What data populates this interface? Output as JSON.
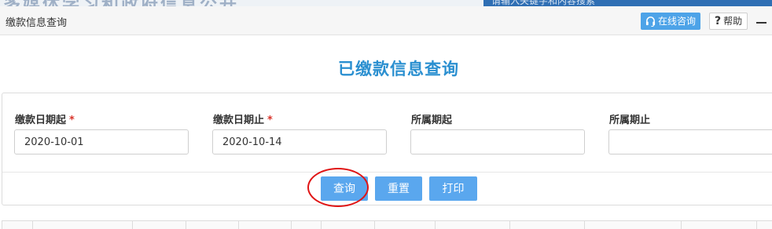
{
  "background": {
    "text_left": "多媒体学习和政府信息公开",
    "text_right": "请输入关键字和内容搜索"
  },
  "titlebar": {
    "title": "缴款信息查询",
    "online_label": "在线咨询",
    "help_label": "帮助",
    "online_icon": "headset-icon",
    "help_icon": "question-icon",
    "minimize_icon": "minimize-icon"
  },
  "page": {
    "title": "已缴款信息查询"
  },
  "form": {
    "fields": [
      {
        "label": "缴款日期起",
        "required_mark": "*",
        "value": "2020-10-01"
      },
      {
        "label": "缴款日期止",
        "required_mark": "*",
        "value": "2020-10-14"
      },
      {
        "label": "所属期起",
        "value": ""
      },
      {
        "label": "所属期止",
        "value": ""
      }
    ]
  },
  "actions": {
    "query": "查询",
    "reset": "重置",
    "print": "打印"
  },
  "colors": {
    "accent": "#2a8fd0",
    "button": "#5aa7ee",
    "required": "#d9342b",
    "highlight_circle": "#e01414"
  }
}
